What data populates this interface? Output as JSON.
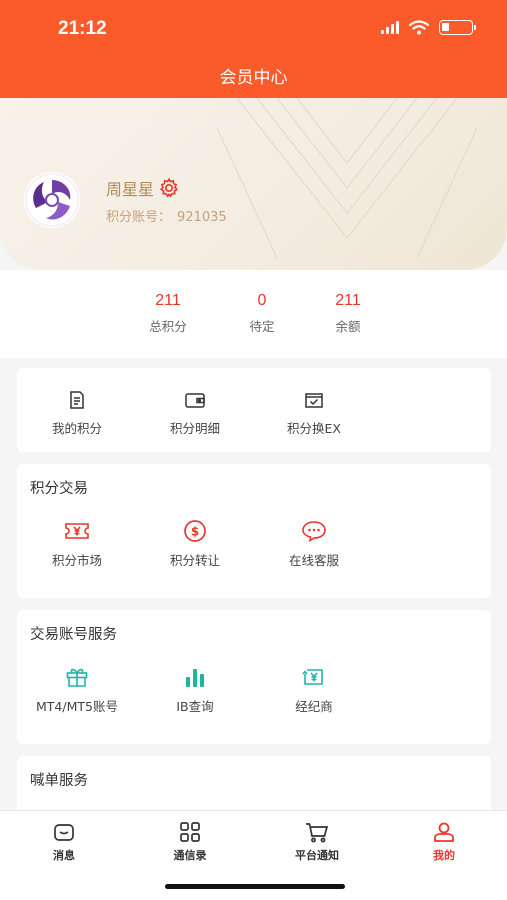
{
  "status_bar": {
    "time": "21:12"
  },
  "header": {
    "title": "会员中心"
  },
  "profile": {
    "name": "周星星",
    "account_label": "积分账号：",
    "account_number": "921035"
  },
  "stats": [
    {
      "value": "211",
      "label": "总积分"
    },
    {
      "value": "0",
      "label": "待定"
    },
    {
      "value": "211",
      "label": "余额"
    }
  ],
  "quick_menu": [
    {
      "label": "我的积分",
      "icon": "document-icon"
    },
    {
      "label": "积分明细",
      "icon": "wallet-icon"
    },
    {
      "label": "积分换EX",
      "icon": "exchange-box-icon"
    }
  ],
  "points_trade": {
    "title": "积分交易",
    "items": [
      {
        "label": "积分市场",
        "icon": "yen-ticket-icon"
      },
      {
        "label": "积分转让",
        "icon": "dollar-circle-icon"
      },
      {
        "label": "在线客服",
        "icon": "chat-bubble-icon"
      }
    ]
  },
  "account_service": {
    "title": "交易账号服务",
    "items": [
      {
        "label": "MT4/MT5账号",
        "icon": "gift-icon"
      },
      {
        "label": "IB查询",
        "icon": "bar-chart-icon"
      },
      {
        "label": "经纪商",
        "icon": "yen-refresh-icon"
      }
    ]
  },
  "order_service": {
    "title": "喊单服务"
  },
  "tabbar": [
    {
      "label": "消息",
      "icon": "message-icon"
    },
    {
      "label": "通信录",
      "icon": "grid-icon"
    },
    {
      "label": "平台通知",
      "icon": "cart-icon"
    },
    {
      "label": "我的",
      "icon": "user-icon",
      "active": true
    }
  ],
  "colors": {
    "brand": "#fb5a2b",
    "accent_red": "#e8372b",
    "gold": "#b48a56",
    "teal": "#1bb5a6"
  }
}
